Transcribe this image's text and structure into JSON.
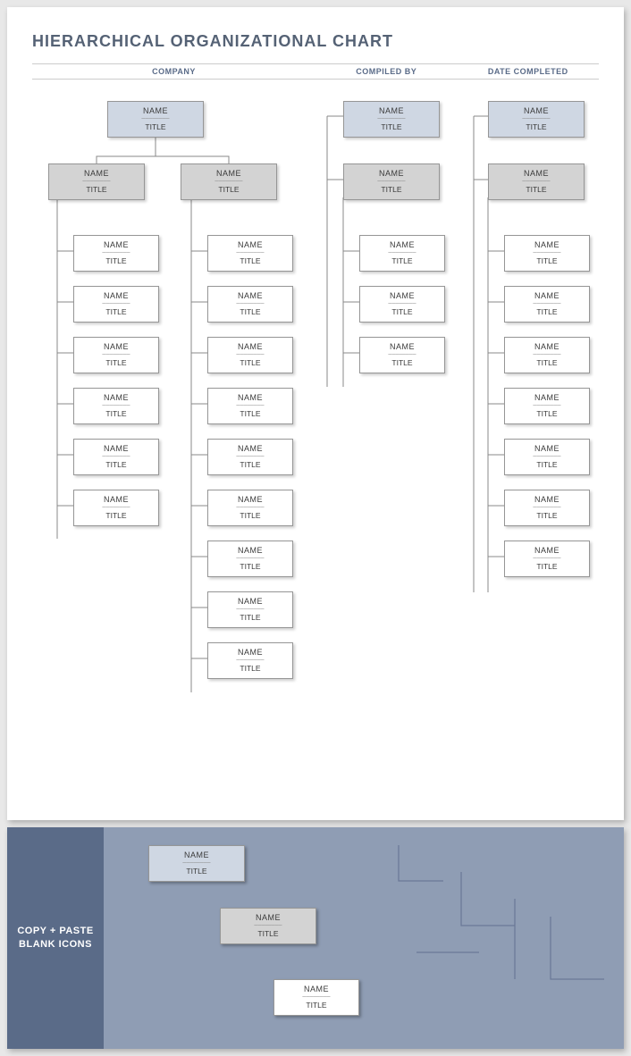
{
  "title": "HIERARCHICAL ORGANIZATIONAL CHART",
  "meta": {
    "company": "COMPANY",
    "compiled": "COMPILED BY",
    "date": "DATE COMPLETED"
  },
  "node_label": {
    "name": "NAME",
    "sep": "––––––––",
    "title": "TITLE"
  },
  "icons_panel": {
    "line1": "COPY + PASTE",
    "line2": "BLANK ICONS"
  },
  "chart_data": {
    "type": "org-chart",
    "columns": {
      "a_top_count": 1,
      "a_mid": [
        "left",
        "right"
      ],
      "a_left_children": 6,
      "a_right_children": 9,
      "b_top_count": 1,
      "b_mid": 1,
      "b_children": 3,
      "c_top_count": 1,
      "c_mid": 1,
      "c_children": 7
    },
    "all_boxes_same_text": true
  }
}
